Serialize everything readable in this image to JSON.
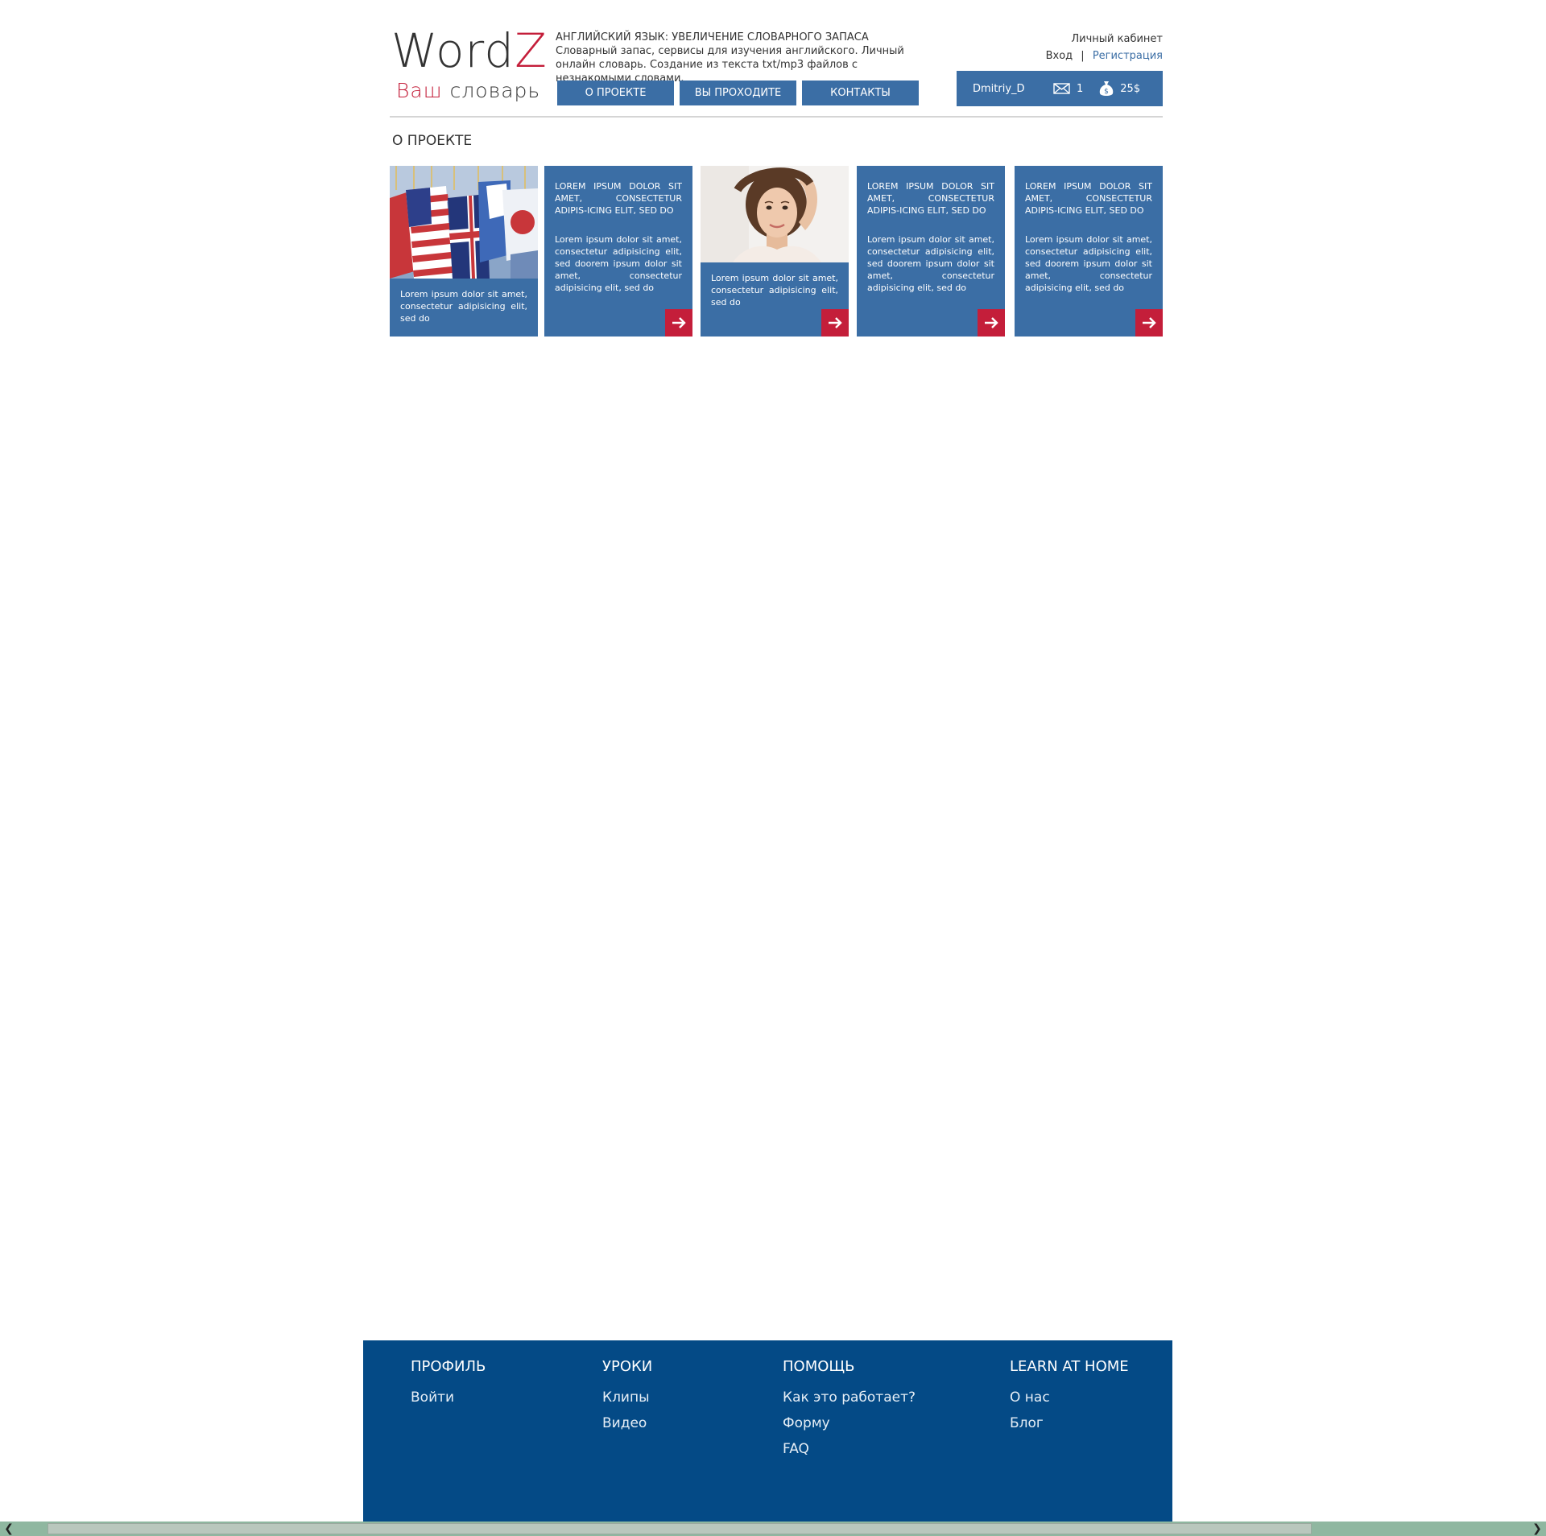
{
  "logo": {
    "title_main": "Word",
    "title_accent": "Z",
    "sub_accent": "Ваш",
    "sub_main": "словарь"
  },
  "header": {
    "heading": "АНГЛИЙСКИЙ ЯЗЫК: УВЕЛИЧЕНИЕ СЛОВАРНОГО ЗАПАСА",
    "description": "Словарный запас, сервисы для изучения английского. Личный онлайн словарь. Создание из текста txt/mp3 файлов с незнакомыми словами."
  },
  "nav": {
    "items": [
      "О ПРОЕКТЕ",
      "ВЫ ПРОХОДИТЕ",
      "КОНТАКТЫ"
    ]
  },
  "account": {
    "title": "Личный кабинет",
    "login": "Вход",
    "separator": "|",
    "register": "Регистрация",
    "username": "Dmitriy_D",
    "messages": "1",
    "balance": "25$"
  },
  "section": {
    "title": "О ПРОЕКТЕ"
  },
  "cards": [
    {
      "type": "image",
      "image": "flags-photo",
      "text": "Lorem ipsum dolor sit amet, consectetur adipisicing elit, sed do"
    },
    {
      "type": "text",
      "heading": "LOREM IPSUM DOLOR SIT AMET, CONSECTETUR ADIPIS-ICING ELIT, SED DO",
      "text": "Lorem ipsum dolor sit amet, consectetur adipisicing elit, sed doorem ipsum dolor sit amet, consectetur adipisicing elit, sed do"
    },
    {
      "type": "image",
      "image": "woman-photo",
      "text": "Lorem ipsum dolor sit amet, consectetur adipisicing elit, sed do"
    },
    {
      "type": "text",
      "heading": "LOREM IPSUM DOLOR SIT AMET, CONSECTETUR ADIPIS-ICING ELIT, SED DO",
      "text": "Lorem ipsum dolor sit amet, consectetur adipisicing elit, sed doorem ipsum dolor sit amet, consectetur adipisicing elit, sed do"
    },
    {
      "type": "text",
      "heading": "LOREM IPSUM DOLOR SIT AMET, CONSECTETUR ADIPIS-ICING ELIT, SED DO",
      "text": "Lorem ipsum dolor sit amet, consectetur adipisicing elit, sed doorem ipsum dolor sit amet, consectetur adipisicing elit, sed do"
    }
  ],
  "footer": {
    "columns": [
      {
        "heading": "ПРОФИЛЬ",
        "links": [
          "Войти"
        ]
      },
      {
        "heading": "УРОКИ",
        "links": [
          "Клипы",
          "Видео"
        ]
      },
      {
        "heading": "ПОМОЩЬ",
        "links": [
          "Как это работает?",
          "Форму",
          "FAQ"
        ]
      },
      {
        "heading": "LEARN AT HOME",
        "links": [
          "О нас",
          "Блог"
        ]
      }
    ]
  },
  "colors": {
    "primary": "#3b6ea5",
    "accent": "#c41e3a",
    "footer": "#044a86"
  },
  "icons": {
    "mail": "mail-icon",
    "money": "money-bag-icon",
    "arrow": "arrow-right-icon"
  }
}
